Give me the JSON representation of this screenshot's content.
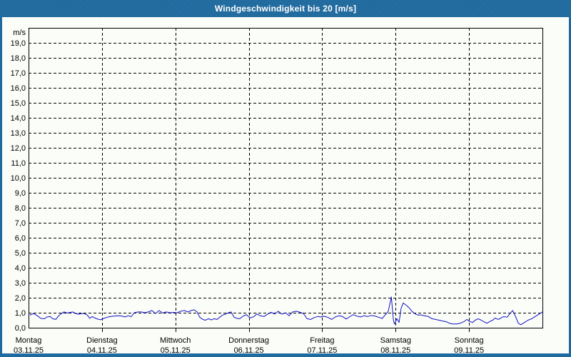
{
  "window": {
    "title": "Windgeschwindigkeit bis 20 [m/s]"
  },
  "colors": {
    "frame": "#1f6ba0",
    "title_text": "#ffffff",
    "background": "#fbfdf9",
    "plot_border": "#000000",
    "grid": "#000000",
    "text": "#000000",
    "line": "#1111c4"
  },
  "chart_data": {
    "type": "line",
    "title": "Windgeschwindigkeit bis 20 [m/s]",
    "ylabel": "m/s",
    "ylim": [
      0,
      20
    ],
    "ytick_step": 1,
    "ytick_labels": [
      "0,0",
      "1,0",
      "2,0",
      "3,0",
      "4,0",
      "5,0",
      "6,0",
      "7,0",
      "8,0",
      "9,0",
      "10,0",
      "11,0",
      "12,0",
      "13,0",
      "14,0",
      "15,0",
      "16,0",
      "17,0",
      "18,0",
      "19,0"
    ],
    "grid": "dashed-both-axes",
    "legend": "none",
    "x_axis": {
      "days": [
        {
          "name": "Montag",
          "date": "03.11.25"
        },
        {
          "name": "Dienstag",
          "date": "04.11.25"
        },
        {
          "name": "Mittwoch",
          "date": "05.11.25"
        },
        {
          "name": "Donnerstag",
          "date": "06.11.25"
        },
        {
          "name": "Freitag",
          "date": "07.11.25"
        },
        {
          "name": "Samstag",
          "date": "08.11.25"
        },
        {
          "name": "Sonntag",
          "date": "09.11.25"
        }
      ]
    },
    "points_x": "percent-across-x-axis",
    "series": [
      {
        "name": "Windgeschwindigkeit",
        "color": "#1111c4",
        "points": [
          [
            0.3,
            0.85
          ],
          [
            1.0,
            0.95
          ],
          [
            1.7,
            0.8
          ],
          [
            2.4,
            0.62
          ],
          [
            3.1,
            0.6
          ],
          [
            3.6,
            0.72
          ],
          [
            4.2,
            0.75
          ],
          [
            4.7,
            0.6
          ],
          [
            5.3,
            0.55
          ],
          [
            5.8,
            0.78
          ],
          [
            6.4,
            0.95
          ],
          [
            6.9,
            1.05
          ],
          [
            7.5,
            0.98
          ],
          [
            8.1,
            1.02
          ],
          [
            8.6,
            1.05
          ],
          [
            9.2,
            0.95
          ],
          [
            9.7,
            0.9
          ],
          [
            10.3,
            0.95
          ],
          [
            10.8,
            0.95
          ],
          [
            11.4,
            0.85
          ],
          [
            11.9,
            0.63
          ],
          [
            12.4,
            0.75
          ],
          [
            12.9,
            0.65
          ],
          [
            13.5,
            0.57
          ],
          [
            14.0,
            0.53
          ],
          [
            14.6,
            0.62
          ],
          [
            15.3,
            0.7
          ],
          [
            16.0,
            0.75
          ],
          [
            16.7,
            0.78
          ],
          [
            17.4,
            0.8
          ],
          [
            18.1,
            0.78
          ],
          [
            18.8,
            0.72
          ],
          [
            19.4,
            0.8
          ],
          [
            20.0,
            0.74
          ],
          [
            20.6,
            1.0
          ],
          [
            21.3,
            1.05
          ],
          [
            21.9,
            1.05
          ],
          [
            22.6,
            1.0
          ],
          [
            23.3,
            1.05
          ],
          [
            24.0,
            1.15
          ],
          [
            24.7,
            0.95
          ],
          [
            25.4,
            1.15
          ],
          [
            26.1,
            0.98
          ],
          [
            26.8,
            1.05
          ],
          [
            27.5,
            1.0
          ],
          [
            28.2,
            1.02
          ],
          [
            28.9,
            1.0
          ],
          [
            29.6,
            1.1
          ],
          [
            30.3,
            1.15
          ],
          [
            31.0,
            1.05
          ],
          [
            31.7,
            1.15
          ],
          [
            32.2,
            1.2
          ],
          [
            32.8,
            1.05
          ],
          [
            33.3,
            0.7
          ],
          [
            33.9,
            0.55
          ],
          [
            34.4,
            0.5
          ],
          [
            35.0,
            0.6
          ],
          [
            35.6,
            0.52
          ],
          [
            36.1,
            0.6
          ],
          [
            36.7,
            0.55
          ],
          [
            37.2,
            0.7
          ],
          [
            37.8,
            0.85
          ],
          [
            38.3,
            0.9
          ],
          [
            38.9,
            1.0
          ],
          [
            39.4,
            1.05
          ],
          [
            40.0,
            0.7
          ],
          [
            40.6,
            0.62
          ],
          [
            41.1,
            0.6
          ],
          [
            41.7,
            0.76
          ],
          [
            42.4,
            0.87
          ],
          [
            43.1,
            0.66
          ],
          [
            43.8,
            0.73
          ],
          [
            44.4,
            0.92
          ],
          [
            45.1,
            0.8
          ],
          [
            45.8,
            0.75
          ],
          [
            46.5,
            0.9
          ],
          [
            47.2,
            1.03
          ],
          [
            47.9,
            0.92
          ],
          [
            48.6,
            1.1
          ],
          [
            49.3,
            0.9
          ],
          [
            50.0,
            1.0
          ],
          [
            50.7,
            0.8
          ],
          [
            51.4,
            1.05
          ],
          [
            52.1,
            1.1
          ],
          [
            52.8,
            1.03
          ],
          [
            53.5,
            0.95
          ],
          [
            54.2,
            0.6
          ],
          [
            54.9,
            0.55
          ],
          [
            55.6,
            0.68
          ],
          [
            56.3,
            0.75
          ],
          [
            56.9,
            0.72
          ],
          [
            57.6,
            0.76
          ],
          [
            58.3,
            0.68
          ],
          [
            59.0,
            0.55
          ],
          [
            59.7,
            0.72
          ],
          [
            60.4,
            0.8
          ],
          [
            61.1,
            0.75
          ],
          [
            61.8,
            0.58
          ],
          [
            62.5,
            0.74
          ],
          [
            63.2,
            0.87
          ],
          [
            63.9,
            0.77
          ],
          [
            64.6,
            0.72
          ],
          [
            65.3,
            0.8
          ],
          [
            66.0,
            0.75
          ],
          [
            66.7,
            0.82
          ],
          [
            67.4,
            0.78
          ],
          [
            68.1,
            0.7
          ],
          [
            68.8,
            0.62
          ],
          [
            69.4,
            0.85
          ],
          [
            70.0,
            1.1
          ],
          [
            70.6,
            2.05
          ],
          [
            71.0,
            0.5
          ],
          [
            71.2,
            0.25
          ],
          [
            71.7,
            0.6
          ],
          [
            72.1,
            0.35
          ],
          [
            72.5,
            1.3
          ],
          [
            72.9,
            1.65
          ],
          [
            73.5,
            1.5
          ],
          [
            74.0,
            1.35
          ],
          [
            74.6,
            1.1
          ],
          [
            75.1,
            0.95
          ],
          [
            75.7,
            0.85
          ],
          [
            76.4,
            0.85
          ],
          [
            77.1,
            0.8
          ],
          [
            77.8,
            0.75
          ],
          [
            78.5,
            0.6
          ],
          [
            79.2,
            0.55
          ],
          [
            79.9,
            0.5
          ],
          [
            80.6,
            0.45
          ],
          [
            81.3,
            0.4
          ],
          [
            81.9,
            0.3
          ],
          [
            82.6,
            0.25
          ],
          [
            83.3,
            0.25
          ],
          [
            84.0,
            0.3
          ],
          [
            84.7,
            0.4
          ],
          [
            85.3,
            0.55
          ],
          [
            85.8,
            0.42
          ],
          [
            86.4,
            0.35
          ],
          [
            86.9,
            0.5
          ],
          [
            87.5,
            0.6
          ],
          [
            88.1,
            0.5
          ],
          [
            88.6,
            0.4
          ],
          [
            89.2,
            0.3
          ],
          [
            89.7,
            0.4
          ],
          [
            90.3,
            0.5
          ],
          [
            90.8,
            0.65
          ],
          [
            91.4,
            0.55
          ],
          [
            91.9,
            0.65
          ],
          [
            92.5,
            0.75
          ],
          [
            93.1,
            0.7
          ],
          [
            93.6,
            0.9
          ],
          [
            94.2,
            1.15
          ],
          [
            94.7,
            0.8
          ],
          [
            95.3,
            0.3
          ],
          [
            95.8,
            0.2
          ],
          [
            96.5,
            0.35
          ],
          [
            97.2,
            0.5
          ],
          [
            97.9,
            0.6
          ],
          [
            98.6,
            0.75
          ],
          [
            99.3,
            0.9
          ],
          [
            100.0,
            1.05
          ]
        ]
      }
    ]
  }
}
